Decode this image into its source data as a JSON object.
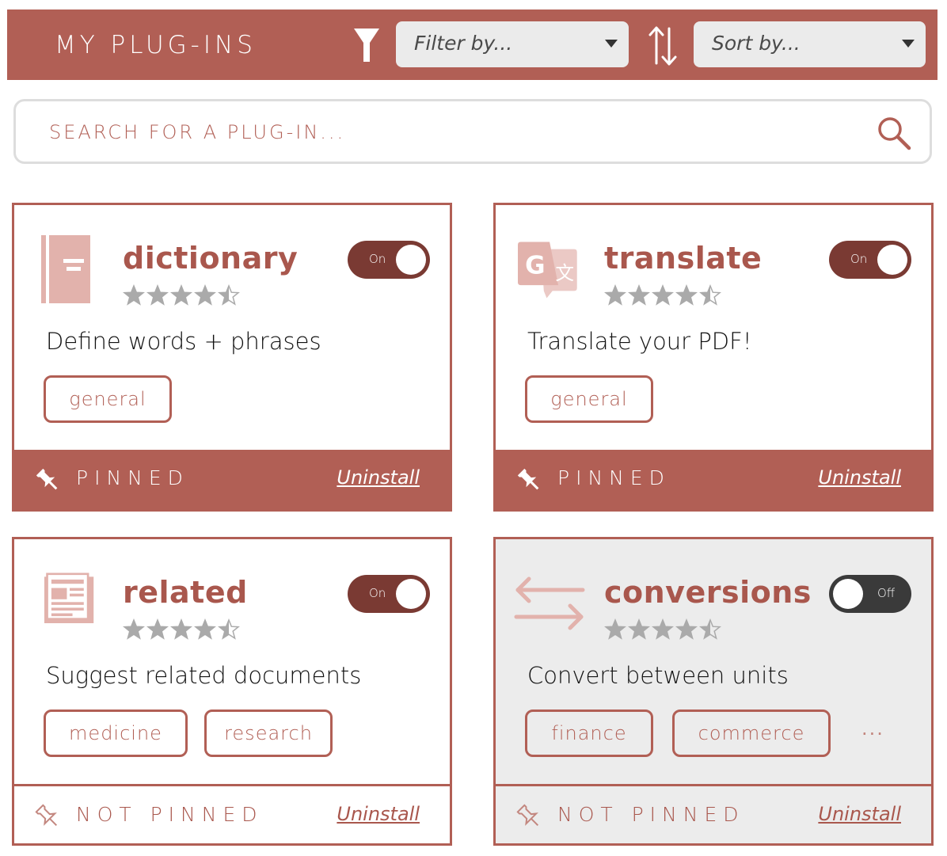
{
  "header": {
    "title": "MY PLUG-INS",
    "filter_icon": "filter-icon",
    "filter_placeholder": "Filter by...",
    "sort_icon": "sort-icon",
    "sort_placeholder": "Sort by..."
  },
  "search": {
    "placeholder": "SEARCH FOR A PLUG-IN...",
    "icon": "search-icon"
  },
  "colors": {
    "accent": "#b15f55",
    "toggle_on": "#7a3a33",
    "toggle_off": "#3a3a3a",
    "disabled_card": "#ececec",
    "star": "#aaaaaa"
  },
  "plugins": [
    {
      "name": "dictionary",
      "icon": "book-icon",
      "rating": 4.5,
      "enabled": true,
      "toggle_label": "On",
      "description": "Define words + phrases",
      "tags": [
        "general"
      ],
      "more_tags": "",
      "pinned": true,
      "pin_label": "PINNED",
      "uninstall_label": "Uninstall"
    },
    {
      "name": "translate",
      "icon": "translate-icon",
      "rating": 4.5,
      "enabled": true,
      "toggle_label": "On",
      "description": "Translate your PDF!",
      "tags": [
        "general"
      ],
      "more_tags": "",
      "pinned": true,
      "pin_label": "PINNED",
      "uninstall_label": "Uninstall"
    },
    {
      "name": "related",
      "icon": "newspaper-icon",
      "rating": 4.5,
      "enabled": true,
      "toggle_label": "On",
      "description": "Suggest related documents",
      "tags": [
        "medicine",
        "research"
      ],
      "more_tags": "",
      "pinned": false,
      "pin_label": "NOT PINNED",
      "uninstall_label": "Uninstall"
    },
    {
      "name": "conversions",
      "icon": "exchange-arrows-icon",
      "rating": 4.5,
      "enabled": false,
      "toggle_label": "Off",
      "description": "Convert between units",
      "tags": [
        "finance",
        "commerce"
      ],
      "more_tags": "...",
      "pinned": false,
      "pin_label": "NOT PINNED",
      "uninstall_label": "Uninstall"
    }
  ]
}
